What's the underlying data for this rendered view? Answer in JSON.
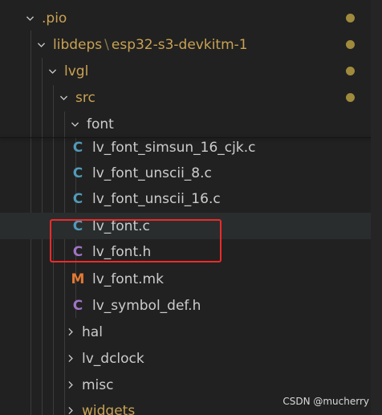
{
  "explorer": {
    "rows": [
      {
        "label": ".pio",
        "kind": "folder",
        "expanded": true,
        "modified": true
      },
      {
        "label_parts": [
          "libdeps",
          "esp32-s3-devkitm-1"
        ],
        "separator": "\\",
        "kind": "folder",
        "expanded": true,
        "modified": true
      },
      {
        "label": "lvgl",
        "kind": "folder",
        "expanded": true,
        "modified": true
      },
      {
        "label": "src",
        "kind": "folder",
        "expanded": true,
        "modified": true
      },
      {
        "label": "font",
        "kind": "folder",
        "expanded": true,
        "modified": false
      },
      {
        "label": "lv_font_simsun_16_cjk.c",
        "kind": "file",
        "icon": "C"
      },
      {
        "label": "lv_font_unscii_8.c",
        "kind": "file",
        "icon": "C"
      },
      {
        "label": "lv_font_unscii_16.c",
        "kind": "file",
        "icon": "C"
      },
      {
        "label": "lv_font.c",
        "kind": "file",
        "icon": "C"
      },
      {
        "label": "lv_font.h",
        "kind": "file",
        "icon": "C"
      },
      {
        "label": "lv_font.mk",
        "kind": "file",
        "icon": "M"
      },
      {
        "label": "lv_symbol_def.h",
        "kind": "file",
        "icon": "C"
      },
      {
        "label": "hal",
        "kind": "folder",
        "expanded": false
      },
      {
        "label": "lv_dclock",
        "kind": "folder",
        "expanded": false
      },
      {
        "label": "misc",
        "kind": "folder",
        "expanded": false
      },
      {
        "label": "widgets",
        "kind": "folder",
        "expanded": false,
        "modified": true
      }
    ]
  },
  "watermark": "CSDN @mucherry",
  "colors": {
    "background": "#212121",
    "text": "#cccccc",
    "modified_text": "#c9a253",
    "c_icon": "#519aba",
    "h_icon": "#a074c4",
    "mk_icon": "#e37933",
    "annotation_box": "#ee2a2a"
  }
}
